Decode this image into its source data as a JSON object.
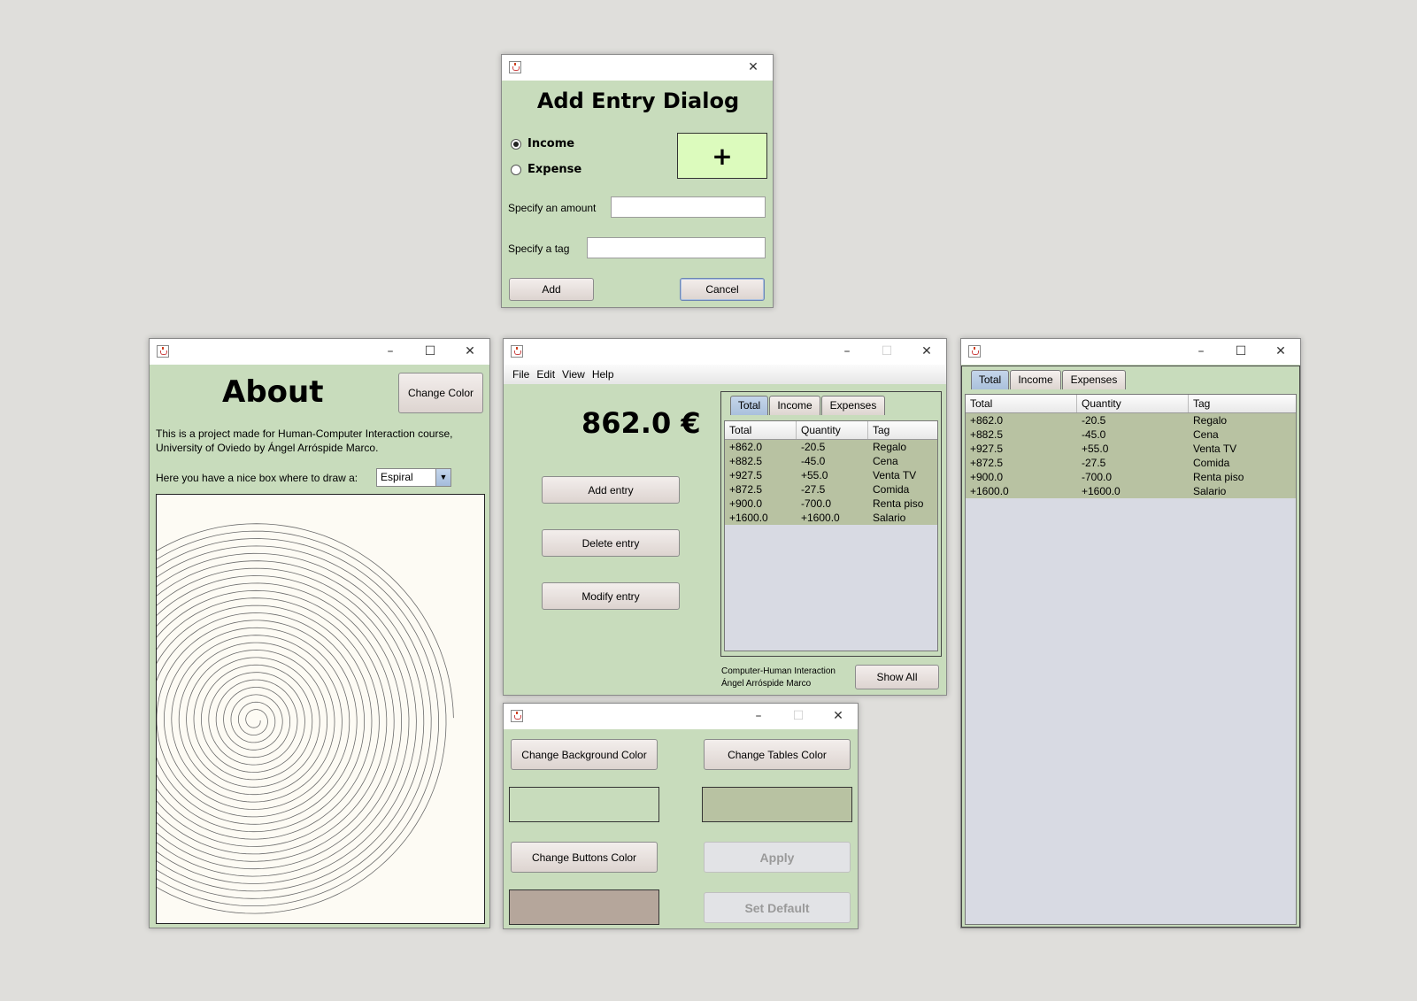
{
  "add_dialog": {
    "title": "Add Entry Dialog",
    "radio_income": "Income",
    "radio_expense": "Expense",
    "sign_symbol": "+",
    "amount_label": "Specify an amount",
    "amount_value": "",
    "tag_label": "Specify a tag",
    "tag_value": "",
    "add_button": "Add",
    "cancel_button": "Cancel",
    "sign_color": "#dcfbbd"
  },
  "about": {
    "title": "About",
    "change_color_button": "Change Color",
    "description_line1": "This is a project made for Human-Computer Interaction course,",
    "description_line2": "University of Oviedo by Ángel Arróspide Marco.",
    "draw_label": "Here you have a nice box where to draw a:",
    "shape_select": "Espiral",
    "canvas_color": "#fdfbf4"
  },
  "main": {
    "menu": [
      "File",
      "Edit",
      "View",
      "Help"
    ],
    "balance": "862.0 €",
    "add_button": "Add entry",
    "delete_button": "Delete entry",
    "modify_button": "Modify entry",
    "tabs": [
      "Total",
      "Income",
      "Expenses"
    ],
    "columns": [
      "Total",
      "Quantity",
      "Tag"
    ],
    "rows": [
      [
        "+862.0",
        "-20.5",
        "Regalo"
      ],
      [
        "+882.5",
        "-45.0",
        "Cena"
      ],
      [
        "+927.5",
        "+55.0",
        "Venta TV"
      ],
      [
        "+872.5",
        "-27.5",
        "Comida"
      ],
      [
        "+900.0",
        "-700.0",
        "Renta piso"
      ],
      [
        "+1600.0",
        "+1600.0",
        "Salario"
      ]
    ],
    "credit_line1": "Computer-Human Interaction",
    "credit_line2": "Ángel Arróspide Marco",
    "show_all_button": "Show All"
  },
  "colors_window": {
    "bg_button": "Change Background Color",
    "tables_button": "Change Tables Color",
    "buttons_button": "Change Buttons Color",
    "apply_button": "Apply",
    "default_button": "Set Default",
    "bg_swatch": "#c8dcbc",
    "tables_swatch": "#b8c2a2",
    "buttons_swatch": "#b5a69b"
  },
  "full_table": {
    "tabs": [
      "Total",
      "Income",
      "Expenses"
    ],
    "columns": [
      "Total",
      "Quantity",
      "Tag"
    ],
    "rows": [
      [
        "+862.0",
        "-20.5",
        "Regalo"
      ],
      [
        "+882.5",
        "-45.0",
        "Cena"
      ],
      [
        "+927.5",
        "+55.0",
        "Venta TV"
      ],
      [
        "+872.5",
        "-27.5",
        "Comida"
      ],
      [
        "+900.0",
        "-700.0",
        "Renta piso"
      ],
      [
        "+1600.0",
        "+1600.0",
        "Salario"
      ]
    ]
  }
}
